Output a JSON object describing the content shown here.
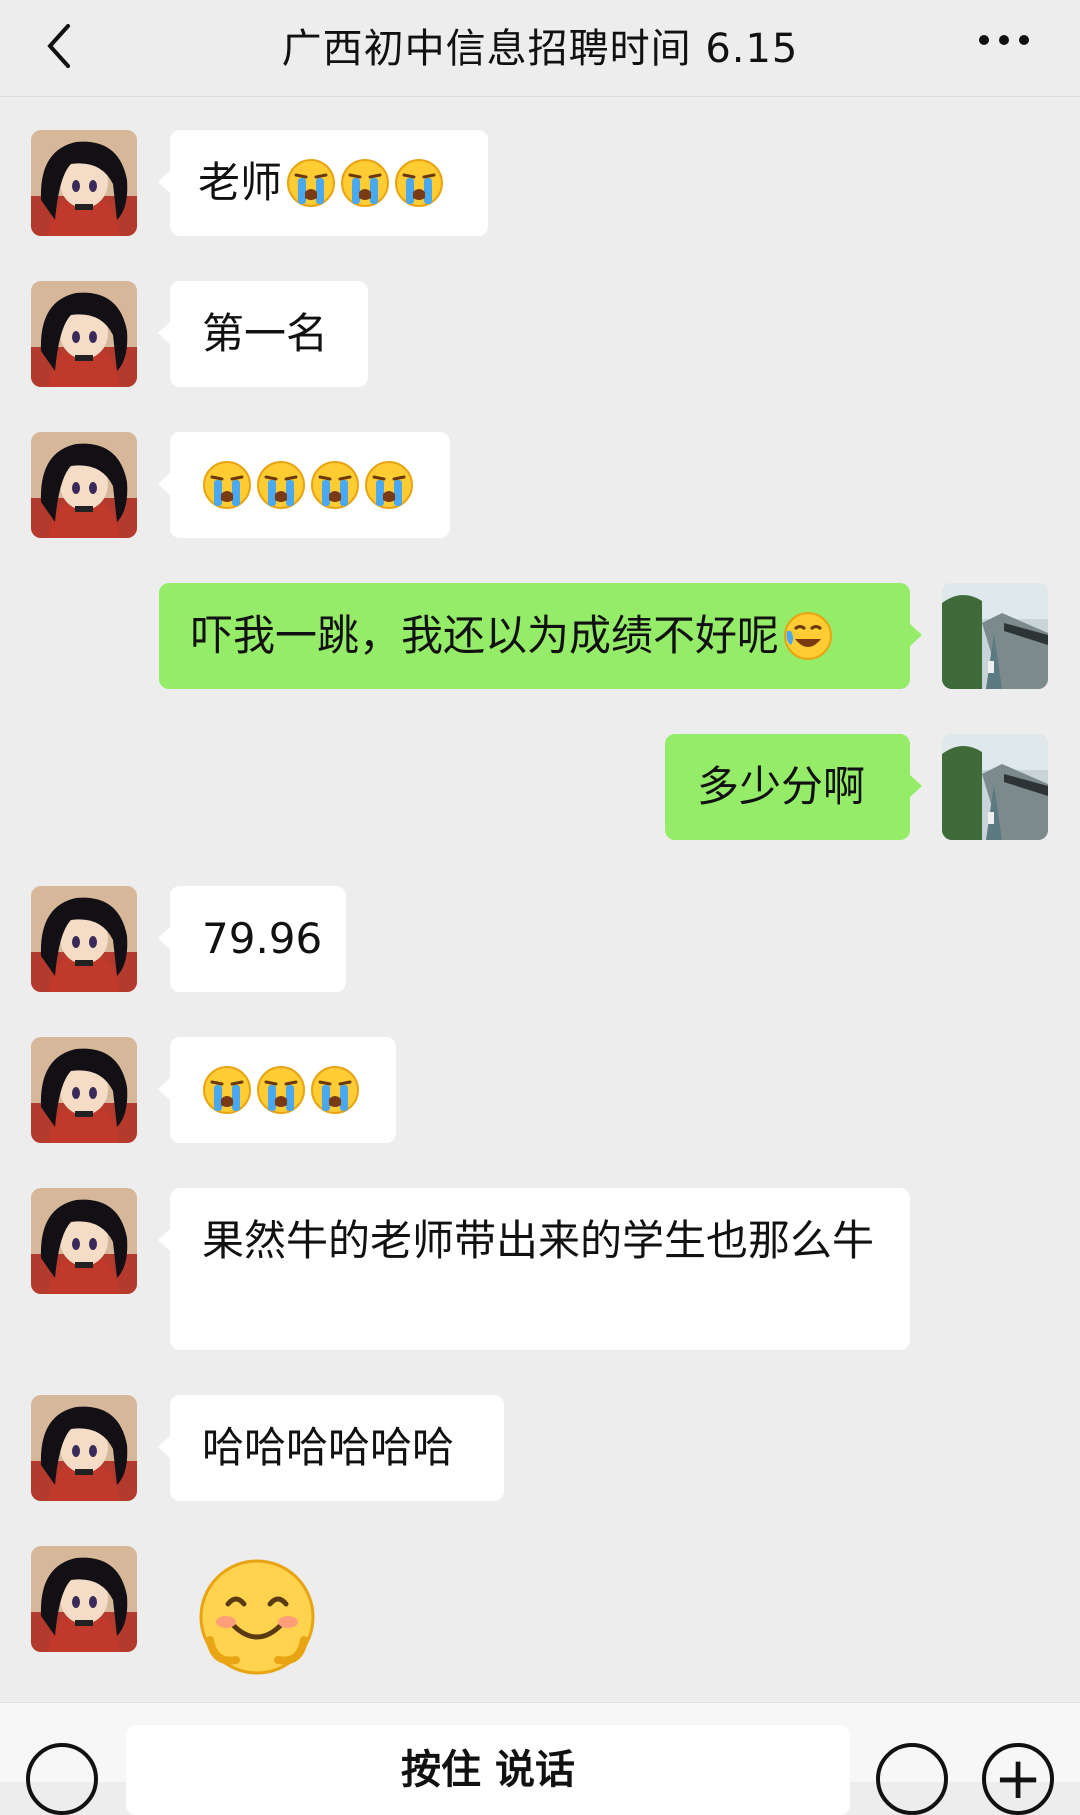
{
  "header": {
    "title": "广西初中信息招聘时间 6.15",
    "back_icon": "chevron-left-icon",
    "more_icon": "more-horizontal-icon"
  },
  "messages": [
    {
      "from": "other",
      "text": "老师",
      "emoji": [
        "crying-face",
        "crying-face",
        "crying-face"
      ]
    },
    {
      "from": "other",
      "text": "第一名",
      "emoji": []
    },
    {
      "from": "other",
      "text": "",
      "emoji": [
        "crying-face",
        "crying-face",
        "crying-face",
        "crying-face"
      ]
    },
    {
      "from": "me",
      "text": "吓我一跳，我还以为成绩不好呢",
      "emoji": [
        "laugh-cry-face"
      ]
    },
    {
      "from": "me",
      "text": "多少分啊",
      "emoji": []
    },
    {
      "from": "other",
      "text": "79.96",
      "emoji": []
    },
    {
      "from": "other",
      "text": "",
      "emoji": [
        "crying-face",
        "crying-face",
        "crying-face"
      ]
    },
    {
      "from": "other",
      "text": "果然牛的老师带出来的学生也那么牛",
      "emoji": []
    },
    {
      "from": "other",
      "text": "哈哈哈哈哈哈",
      "emoji": []
    },
    {
      "from": "other",
      "text": "",
      "emoji": [
        "smiling-sticker"
      ]
    }
  ],
  "toolbar": {
    "voice_keyboard_icon": "keyboard-icon",
    "press_to_talk_label": "按住 说话",
    "emoji_icon": "face-icon",
    "more_icon": "plus-icon"
  },
  "colors": {
    "background": "#ededed",
    "incoming_bubble": "#ffffff",
    "outgoing_bubble": "#95ec69"
  }
}
